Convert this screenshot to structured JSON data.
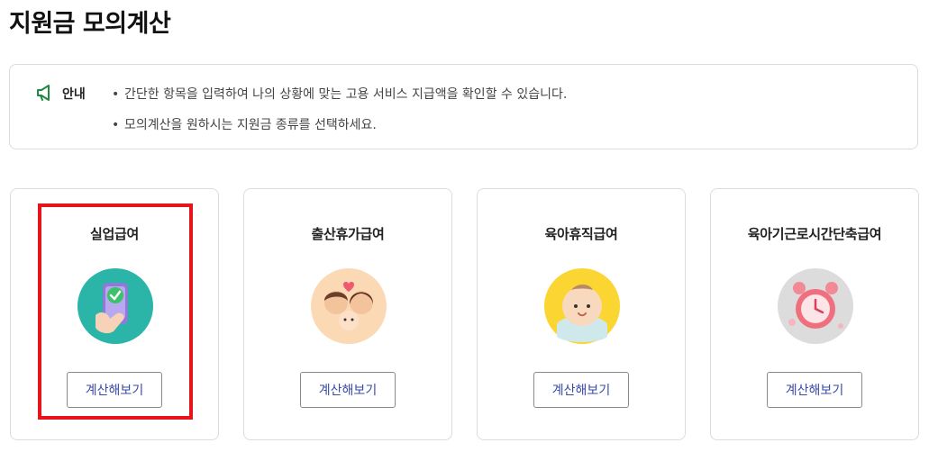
{
  "page": {
    "title": "지원금 모의계산"
  },
  "notice": {
    "icon": "megaphone-icon",
    "label": "안내",
    "bullet": "•",
    "lines": [
      "간단한 항목을 입력하여 나의 상황에 맞는 고용 서비스 지급액을 확인할 수 있습니다.",
      "모의계산을 원하시는 지원금 종류를 선택하세요."
    ]
  },
  "cards": [
    {
      "title": "실업급여",
      "button_label": "계산해보기",
      "icon": "smartphone-check-icon",
      "icon_bg": "#2bb5a8"
    },
    {
      "title": "출산휴가급여",
      "button_label": "계산해보기",
      "icon": "parents-baby-icon",
      "icon_bg": "#fbd9b5"
    },
    {
      "title": "육아휴직급여",
      "button_label": "계산해보기",
      "icon": "baby-face-icon",
      "icon_bg": "#fbd531"
    },
    {
      "title": "육아기근로시간단축급여",
      "button_label": "계산해보기",
      "icon": "alarm-clock-icon",
      "icon_bg": "#dcdcdc"
    }
  ],
  "colors": {
    "highlight": "#e8141b",
    "button_text": "#3a4aa8",
    "notice_icon": "#1f8a3d"
  }
}
